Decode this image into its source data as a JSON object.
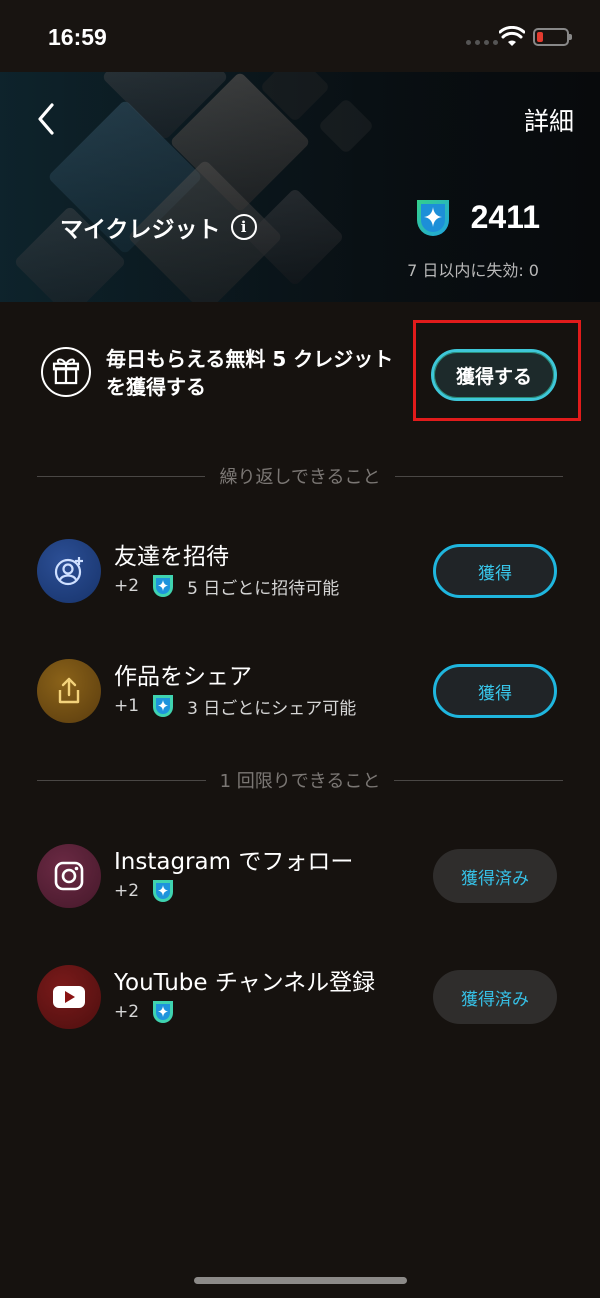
{
  "status_bar": {
    "time": "16:59",
    "battery_color": "#e23b2f"
  },
  "header": {
    "back_icon": "chevron-left-icon",
    "details_label": "詳細"
  },
  "credits": {
    "title": "マイクレジット",
    "info_icon": "i",
    "balance": "2411",
    "expiring_text": "7 日以内に失効: 0"
  },
  "daily_bonus": {
    "icon": "gift-icon",
    "text_line1": "毎日もらえる無料 5 クレジット",
    "text_line2": "を獲得する",
    "button_label": "獲得する"
  },
  "sections": {
    "repeatable": "繰り返しできること",
    "one_time": "1 回限りできること"
  },
  "tasks": [
    {
      "title": "友達を招待",
      "reward": "+2",
      "note": "5 日ごとに招待可能",
      "button": "獲得",
      "icon": "user-add-icon",
      "color": "#1c3a75"
    },
    {
      "title": "作品をシェア",
      "reward": "+1",
      "note": "3 日ごとにシェア可能",
      "button": "獲得",
      "icon": "share-icon",
      "color": "#6b4a12"
    },
    {
      "title": "Instagram でフォロー",
      "reward": "+2",
      "note": "",
      "button": "獲得済み",
      "icon": "instagram-icon",
      "color": "#5a2037"
    },
    {
      "title": "YouTube チャンネル登録",
      "reward": "+2",
      "note": "",
      "button": "獲得済み",
      "icon": "youtube-icon",
      "color": "#5d1414"
    }
  ],
  "colors": {
    "accent": "#38c6ea",
    "highlight_border": "#e11b1b",
    "background": "#16120f"
  }
}
